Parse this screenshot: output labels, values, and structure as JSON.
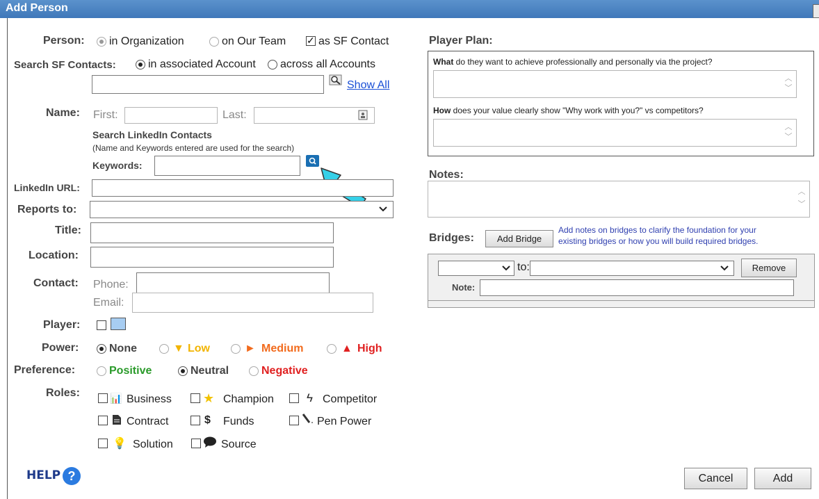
{
  "dialog": {
    "title": "Add Person"
  },
  "person": {
    "label": "Person:",
    "opt_org": "in Organization",
    "opt_team": "on Our Team",
    "opt_sf": "as SF Contact"
  },
  "search_sf": {
    "label": "Search SF Contacts:",
    "opt_account": "in associated Account",
    "opt_all": "across all Accounts",
    "show_all": "Show All"
  },
  "name": {
    "label": "Name:",
    "first": "First:",
    "last": "Last:"
  },
  "linkedin": {
    "heading": "Search LinkedIn Contacts",
    "note": "(Name and Keywords entered are used for the search)",
    "keywords_label": "Keywords:",
    "url_label": "LinkedIn URL:"
  },
  "fields": {
    "reports_to": "Reports to:",
    "title": "Title:",
    "location": "Location:",
    "contact": "Contact:",
    "phone": "Phone:",
    "email": "Email:",
    "player": "Player:"
  },
  "power": {
    "label": "Power:",
    "none": "None",
    "low": "Low",
    "medium": "Medium",
    "high": "High",
    "low_icon": "▼",
    "medium_icon": "►",
    "high_icon": "▲"
  },
  "preference": {
    "label": "Preference:",
    "positive": "Positive",
    "neutral": "Neutral",
    "negative": "Negative"
  },
  "roles": {
    "label": "Roles:",
    "items": [
      "Business",
      "Champion",
      "Competitor",
      "Contract",
      "Funds",
      "Pen Power",
      "Solution",
      "Source"
    ]
  },
  "player_plan": {
    "heading": "Player Plan:",
    "what_bold": "What",
    "what_rest": " do they want to achieve professionally and personally via the project?",
    "how_bold": "How",
    "how_rest": " does your value clearly show \"Why work with you?\" vs competitors?"
  },
  "notes": {
    "heading": "Notes:"
  },
  "bridges": {
    "label": "Bridges:",
    "add_button": "Add Bridge",
    "hint_line1": "Add notes on bridges to clarify the foundation for your",
    "hint_line2": "existing bridges or how you will build required bridges.",
    "to_label": "to:",
    "remove_button": "Remove",
    "note_label": "Note:"
  },
  "footer": {
    "help": "HELP",
    "cancel": "Cancel",
    "add": "Add"
  },
  "colors": {
    "titlebar": "#4a84c3",
    "low": "#f2b400",
    "medium": "#f26b1d",
    "high": "#e02020",
    "positive": "#2a9a2a",
    "negative": "#e02020",
    "hint": "#3040b0"
  }
}
